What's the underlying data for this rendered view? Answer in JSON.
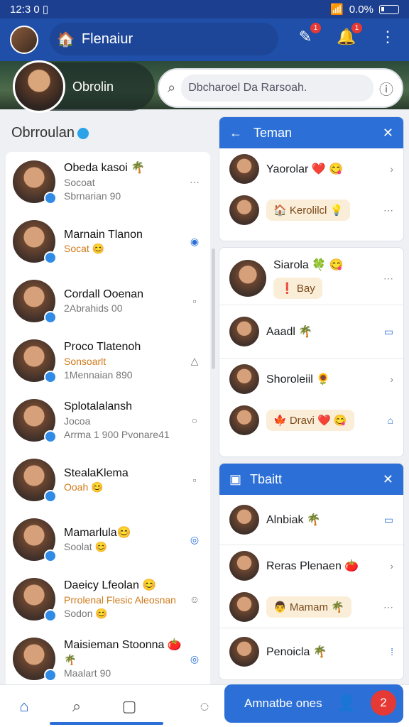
{
  "status": {
    "time": "12:3 0 ▯",
    "battery": "0.0%"
  },
  "appbar": {
    "title": "Flenaiur",
    "badge_edit": "1",
    "badge_bell": "1"
  },
  "profile": {
    "name": "Obrolin"
  },
  "search": {
    "placeholder": "Dbcharoel Da Rarsoah."
  },
  "left": {
    "title": "Obrroulan",
    "rows": [
      {
        "name": "Obeda kasoi 🌴",
        "sub1": "Socoat",
        "sub2": "Sbrnarian 90",
        "action": "⋯",
        "orange": false
      },
      {
        "name": "Marnain Tlanon",
        "sub1": "Socat 😊",
        "sub2": "",
        "action": "◉",
        "orange": true
      },
      {
        "name": "Cordall Ooenan",
        "sub1": "2Abrahids 00",
        "sub2": "",
        "action": "▫",
        "orange": false
      },
      {
        "name": "Proco Tlatenoh",
        "sub1": "Sonsoarlt",
        "sub2": "1Mennaian 890",
        "action": "△",
        "orange": true
      },
      {
        "name": "Splotalalansh",
        "sub1": "Jocoa",
        "sub2": "Arrma 1 900 Pvonare41",
        "action": "○",
        "orange": false
      },
      {
        "name": "StealaKlema",
        "sub1": "Ooah 😊",
        "sub2": "",
        "action": "▫",
        "orange": true
      },
      {
        "name": "Mamarlula😊",
        "sub1": "Soolat 😊",
        "sub2": "",
        "action": "◎",
        "orange": false
      },
      {
        "name": "Daeicy Lfeolan 😊",
        "sub1": "Prrolenal Flesic Aleosnan",
        "sub2": "Sodon 😊",
        "action": "☺",
        "orange": true
      },
      {
        "name": "Maisieman Stoonna 🍅",
        "sub1": "🌴",
        "sub2": "Maalart 90",
        "action": "◎",
        "orange": false
      }
    ]
  },
  "card1": {
    "title": "Teman",
    "rows": [
      {
        "name": "Yaorolar ❤️ 😋",
        "chip": "",
        "action": "›"
      },
      {
        "name": "",
        "chip": "🏠 Kerolilcl 💡",
        "action": "⋯"
      }
    ]
  },
  "card2": {
    "rows": [
      {
        "name": "Siarola 🍀 😋",
        "chip": "❗ Bay",
        "action": "⋯"
      },
      {
        "name": "Aaadl 🌴",
        "chip": "",
        "action": "▭"
      },
      {
        "name": "Shoroleiil 🌻",
        "chip": "",
        "action": "›"
      },
      {
        "name": "",
        "chip": "🍁 Dravi ❤️ 😋",
        "action": "⌂"
      }
    ]
  },
  "card3": {
    "title": "Tbaitt",
    "rows": [
      {
        "name": "Alnbiak 🌴",
        "chip": "",
        "action": "▭"
      },
      {
        "name": "Reras Plenaen 🍅",
        "chip": "",
        "action": "›"
      },
      {
        "name": "",
        "chip": "👨 Mamam 🌴",
        "action": "⋯"
      },
      {
        "name": "Penoicla 🌴",
        "chip": "",
        "action": "⁞"
      }
    ]
  },
  "fab": {
    "label": "Amnatbe ones",
    "badge": "2"
  }
}
